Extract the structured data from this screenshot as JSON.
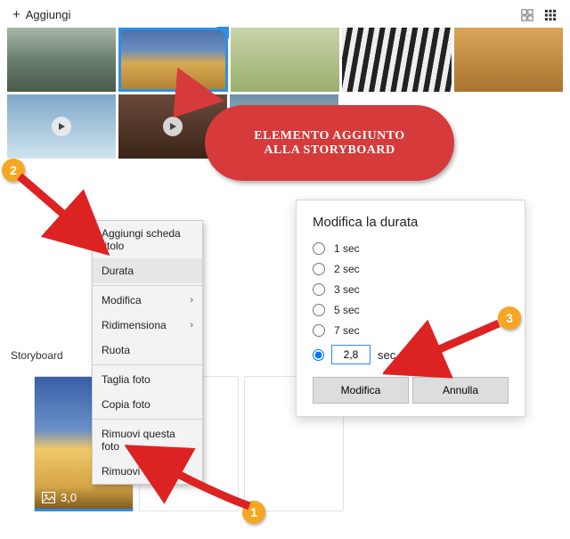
{
  "topbar": {
    "add_label": "Aggiungi"
  },
  "callout": {
    "line1": "ELEMENTO AGGIUNTO",
    "line2": "ALLA STORYBOARD"
  },
  "context_menu": {
    "items": [
      "Aggiungi scheda titolo",
      "Durata",
      "Modifica",
      "Ridimensiona",
      "Ruota",
      "Taglia foto",
      "Copia foto",
      "Rimuovi questa foto",
      "Rimuovi tutto"
    ]
  },
  "duration_panel": {
    "title": "Modifica la durata",
    "options": [
      "1 sec",
      "2 sec",
      "3 sec",
      "5 sec",
      "7 sec"
    ],
    "custom_value": "2,8",
    "sec_label": "sec",
    "ok_label": "Modifica",
    "cancel_label": "Annulla"
  },
  "storyboard": {
    "label": "Storyboard",
    "item_duration": "3,0"
  },
  "badges": {
    "one": "1",
    "two": "2",
    "three": "3"
  }
}
